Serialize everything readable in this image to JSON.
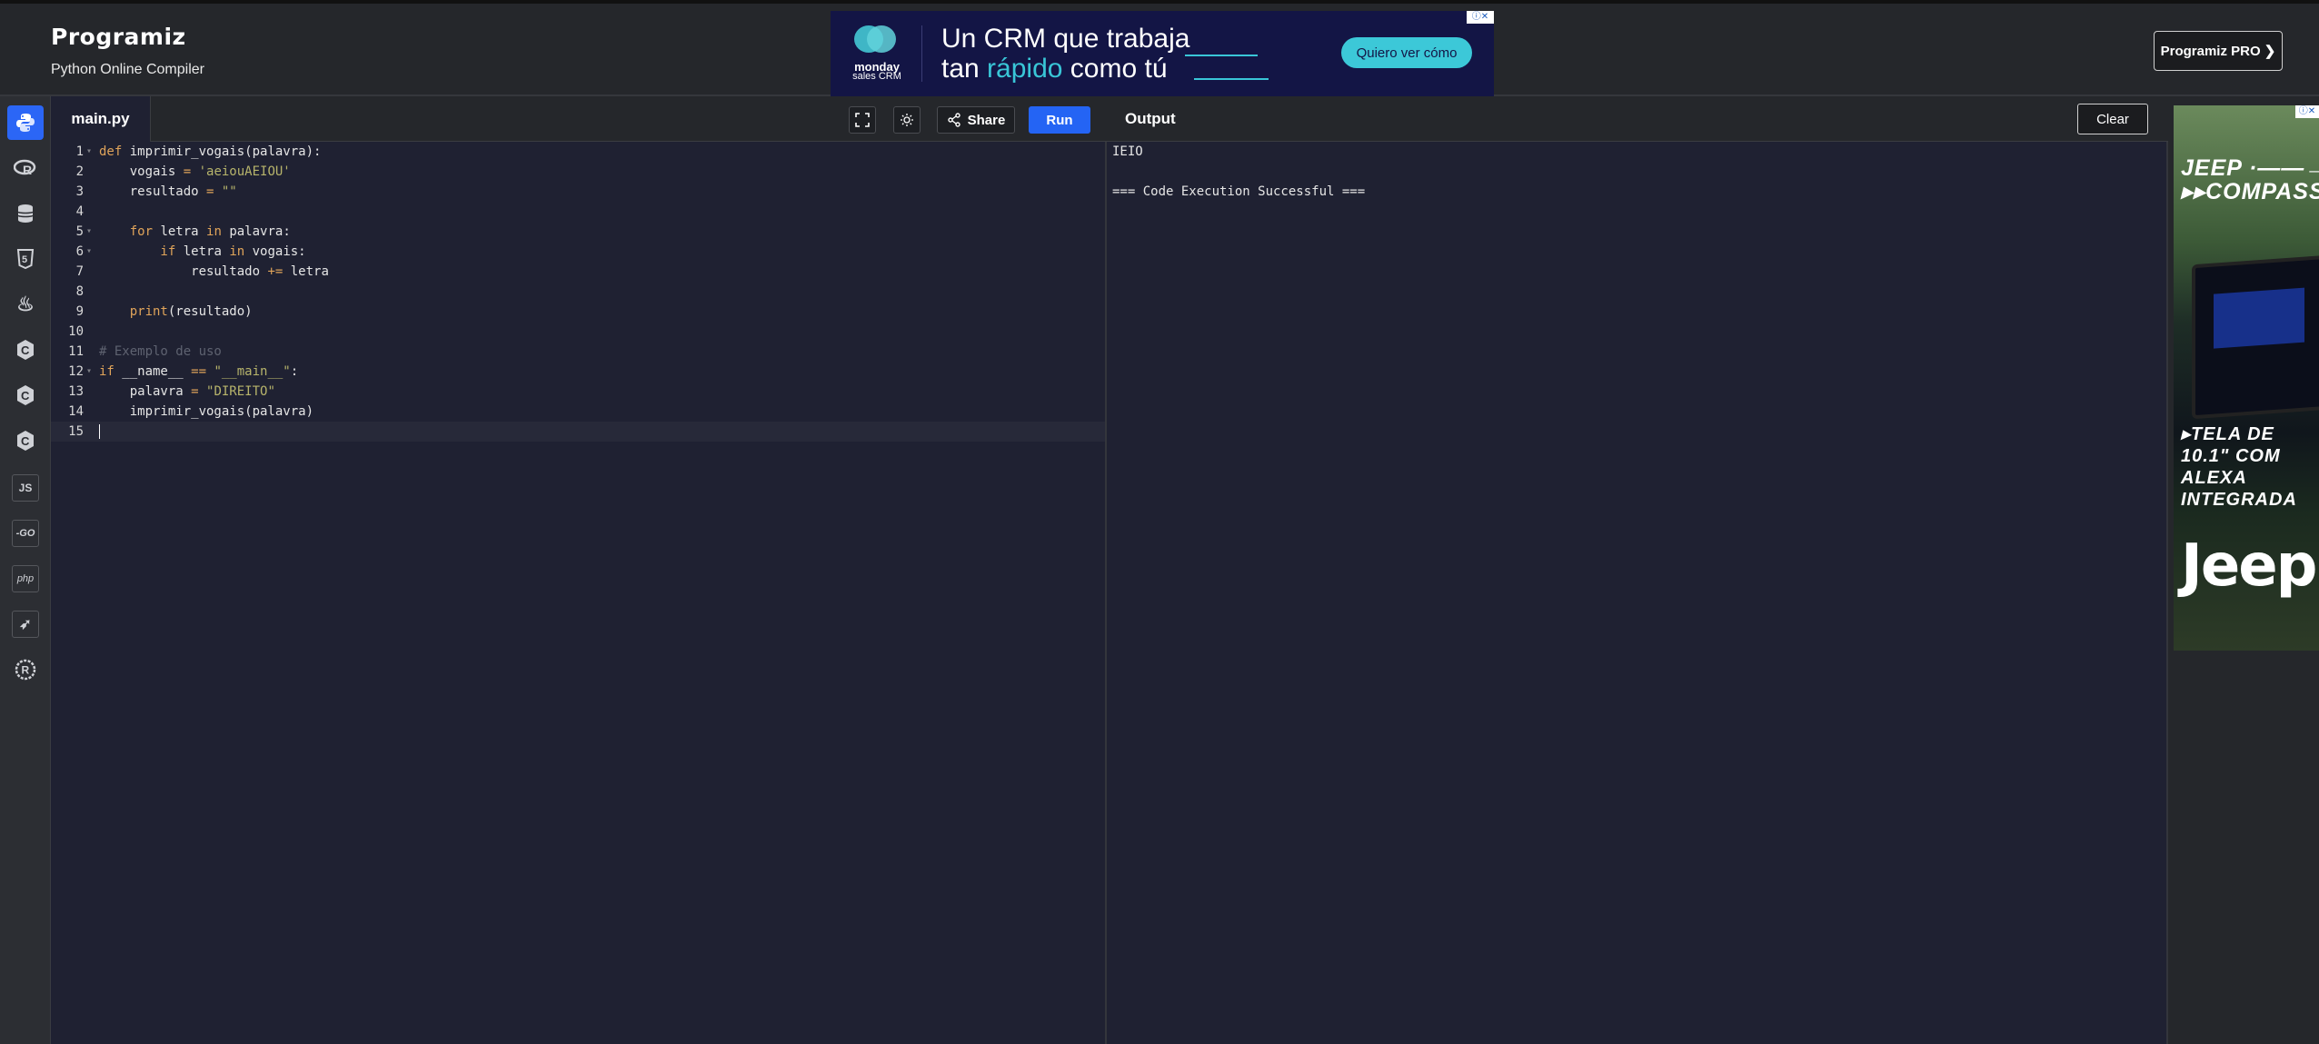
{
  "header": {
    "logo": "Programiz",
    "subtitle": "Python Online Compiler",
    "pro_button": "Programiz PRO ❯"
  },
  "top_ad": {
    "brand_line1": "monday",
    "brand_line2": "sales CRM",
    "headline_line1": "Un CRM que trabaja",
    "headline_line2_pre": "tan ",
    "headline_line2_highlight": "rápido",
    "headline_line2_post": " como tú",
    "cta": "Quiero ver cómo",
    "ad_badge": "ⓘ✕"
  },
  "sidebar": {
    "items": [
      {
        "name": "python",
        "icon": "python-icon",
        "label": "",
        "active": true
      },
      {
        "name": "r",
        "icon": "r-icon",
        "label": "R"
      },
      {
        "name": "sql",
        "icon": "database-icon",
        "label": ""
      },
      {
        "name": "html",
        "icon": "html5-icon",
        "label": "5"
      },
      {
        "name": "java",
        "icon": "java-icon",
        "label": "♨"
      },
      {
        "name": "c",
        "icon": "c-icon",
        "label": "C"
      },
      {
        "name": "cpp",
        "icon": "cpp-icon",
        "label": "C"
      },
      {
        "name": "csharp",
        "icon": "csharp-icon",
        "label": "C"
      },
      {
        "name": "js",
        "icon": "js-icon",
        "label": "JS"
      },
      {
        "name": "go",
        "icon": "go-icon",
        "label": "-GO"
      },
      {
        "name": "php",
        "icon": "php-icon",
        "label": "php"
      },
      {
        "name": "swift",
        "icon": "swift-icon",
        "label": "➶"
      },
      {
        "name": "rust",
        "icon": "rust-icon",
        "label": "R"
      }
    ]
  },
  "editor": {
    "tab_label": "main.py",
    "share_label": "Share",
    "run_label": "Run",
    "lines": [
      {
        "n": "1",
        "fold": true
      },
      {
        "n": "2"
      },
      {
        "n": "3"
      },
      {
        "n": "4"
      },
      {
        "n": "5",
        "fold": true
      },
      {
        "n": "6",
        "fold": true
      },
      {
        "n": "7"
      },
      {
        "n": "8"
      },
      {
        "n": "9"
      },
      {
        "n": "10"
      },
      {
        "n": "11"
      },
      {
        "n": "12",
        "fold": true
      },
      {
        "n": "13"
      },
      {
        "n": "14"
      },
      {
        "n": "15"
      }
    ],
    "code": {
      "l1_kw": "def",
      "l1_rest": " imprimir_vogais(palavra):",
      "l2_pre": "    vogais ",
      "l2_op": "=",
      "l2_str": " 'aeiouAEIOU'",
      "l3_pre": "    resultado ",
      "l3_op": "=",
      "l3_str": " \"\"",
      "l5_kw": "    for",
      "l5_mid": " letra ",
      "l5_kw2": "in",
      "l5_rest": " palavra:",
      "l6_kw": "        if",
      "l6_mid": " letra ",
      "l6_kw2": "in",
      "l6_rest": " vogais:",
      "l7_pre": "            resultado ",
      "l7_op": "+=",
      "l7_rest": " letra",
      "l9_bi": "    print",
      "l9_rest": "(resultado)",
      "l11_cm": "# Exemplo de uso",
      "l12_kw": "if",
      "l12_mid": " __name__ ",
      "l12_op": "==",
      "l12_str": " \"__main__\"",
      "l12_end": ":",
      "l13_pre": "    palavra ",
      "l13_op": "=",
      "l13_str": " \"DIREITO\"",
      "l14": "    imprimir_vogais(palavra)"
    }
  },
  "output": {
    "title": "Output",
    "clear_label": "Clear",
    "lines": [
      "IEIO",
      "",
      "=== Code Execution Successful ==="
    ]
  },
  "side_ad": {
    "headline": "JEEP ·——→\n▸▸COMPASS",
    "feature": "▸TELA DE\n10.1\" COM\nALEXA\nINTEGRADA",
    "brand": "Jeep",
    "ad_badge": "ⓘ✕"
  }
}
